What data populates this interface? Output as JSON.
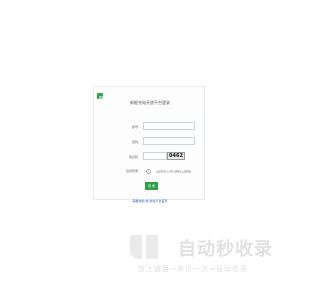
{
  "header": {
    "title": "新能充电开放平台登录"
  },
  "form": {
    "username_label": "账号",
    "password_label": "密码",
    "captcha_label": "验证码",
    "captcha_text": "0462",
    "auto_login_label": "自动登录",
    "auto_login_hint": "(请勿在公共计算机上使用)",
    "submit_label": "登 录",
    "footer_link": "需要协助 或 前往平台首页"
  },
  "watermark": {
    "brand": "自动秒收录",
    "tagline": "放上链接→来访一次→自动收录"
  },
  "colors": {
    "accent": "#2f9f45",
    "link": "#2f66c0"
  }
}
